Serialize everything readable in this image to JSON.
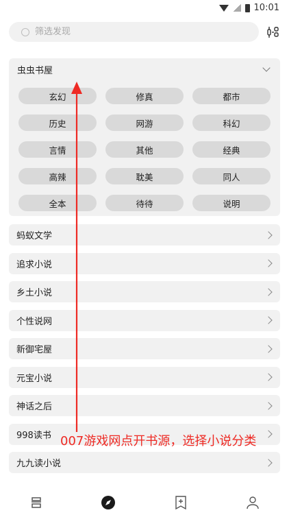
{
  "status": {
    "time": "10:01",
    "icons": [
      "wifi-icon",
      "signal-icon",
      "battery-icon"
    ]
  },
  "search": {
    "placeholder": "筛选发现",
    "icon": "search-icon"
  },
  "filter_button": {
    "icon": "filter-settings-icon"
  },
  "panel": {
    "title": "虫虫书屋",
    "expanded": true,
    "tags": [
      [
        "玄幻",
        "修真",
        "都市"
      ],
      [
        "历史",
        "网游",
        "科幻"
      ],
      [
        "言情",
        "其他",
        "经典"
      ],
      [
        "高辣",
        "耽美",
        "同人"
      ],
      [
        "全本",
        "待待",
        "说明"
      ]
    ]
  },
  "sources": [
    "蚂蚁文学",
    "追求小说",
    "乡土小说",
    "个性说网",
    "新御宅屋",
    "元宝小说",
    "神话之后",
    "998读书",
    "九九读小说"
  ],
  "annotation": {
    "text": "007游戏网点开书源，选择小说分类",
    "color": "#ee2a24"
  },
  "bottom_nav": [
    {
      "name": "bookshelf",
      "icon": "bookshelf-icon",
      "active": false
    },
    {
      "name": "discover",
      "icon": "compass-icon",
      "active": true
    },
    {
      "name": "rss",
      "icon": "bookmark-add-icon",
      "active": false
    },
    {
      "name": "profile",
      "icon": "person-icon",
      "active": false
    }
  ]
}
